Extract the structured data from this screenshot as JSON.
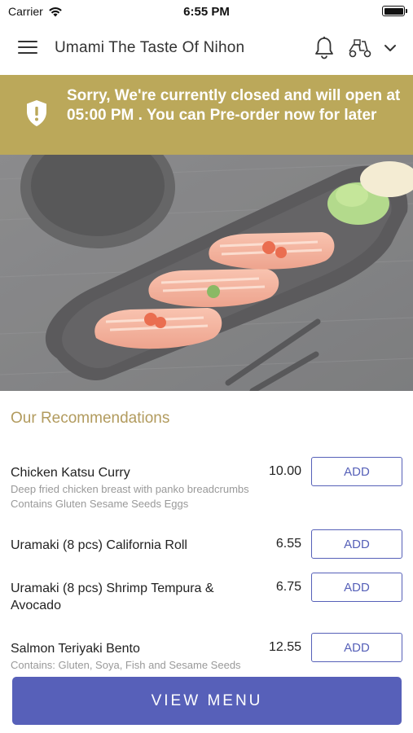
{
  "status_bar": {
    "carrier": "Carrier",
    "time": "6:55 PM"
  },
  "header": {
    "title": "Umami The Taste Of Nihon",
    "icons": [
      "menu-icon",
      "bell-icon",
      "delivery-scooter-icon",
      "chevron-down-icon"
    ]
  },
  "banner": {
    "message": "Sorry, We're currently closed and will open at 05:00 PM . You can Pre-order now for later",
    "color": "#bba85a",
    "icon": "shield-alert-icon"
  },
  "hero": {
    "image": "salmon-nigiri-sushi-photo"
  },
  "recommendations": {
    "title": "Our Recommendations",
    "items": [
      {
        "name": "Chicken Katsu Curry",
        "description": "Deep fried chicken breast with panko breadcrumbs   Contains  Gluten  Sesame Seeds  Eggs",
        "price": "10.00",
        "add_label": "ADD"
      },
      {
        "name": "Uramaki (8 pcs) California Roll",
        "description": "",
        "price": "6.55",
        "add_label": "ADD"
      },
      {
        "name": "Uramaki (8 pcs) Shrimp Tempura & Avocado",
        "description": "",
        "price": "6.75",
        "add_label": "ADD"
      },
      {
        "name": "Salmon Teriyaki Bento",
        "description": "Contains: Gluten, Soya, Fish and Sesame Seeds",
        "price": "12.55",
        "add_label": "ADD"
      }
    ]
  },
  "footer": {
    "view_menu_label": "VIEW MENU",
    "accent": "#5760b9"
  }
}
